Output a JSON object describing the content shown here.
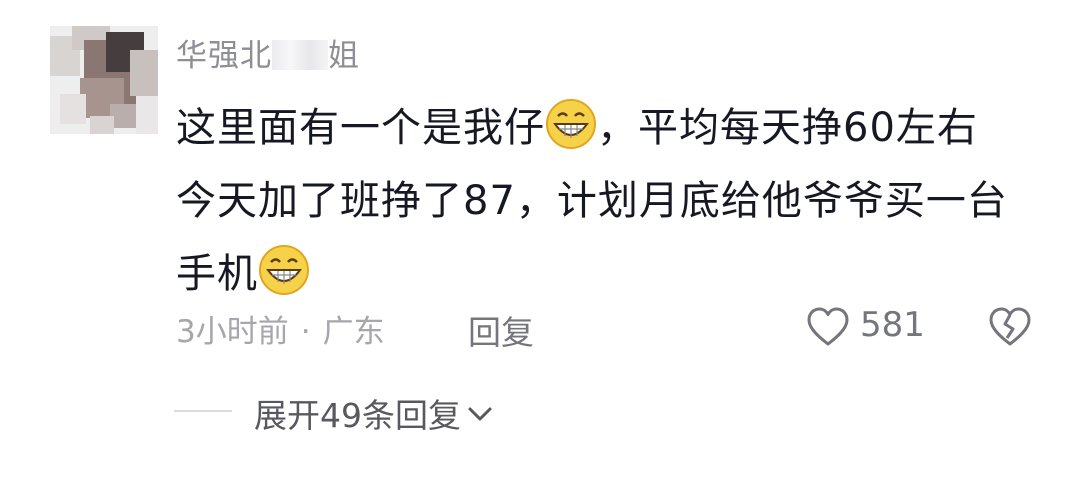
{
  "comment": {
    "username_prefix": "华强北",
    "username_suffix": "姐",
    "text_line1": "这里面有一个是我仔",
    "text_line1_after_emoji": "，平均每天挣60左右",
    "text_line2": "今天加了班挣了87，计划月底给他爷爷买一台",
    "text_line3": "手机",
    "emoji": "grinning-face",
    "time": "3小时前",
    "separator": "·",
    "location": "广东",
    "reply_label": "回复",
    "like_count": "581"
  },
  "replies": {
    "expand_label": "展开49条回复"
  },
  "icons": {
    "like": "heart-outline-icon",
    "dislike": "broken-heart-icon",
    "expand": "chevron-down-icon"
  }
}
